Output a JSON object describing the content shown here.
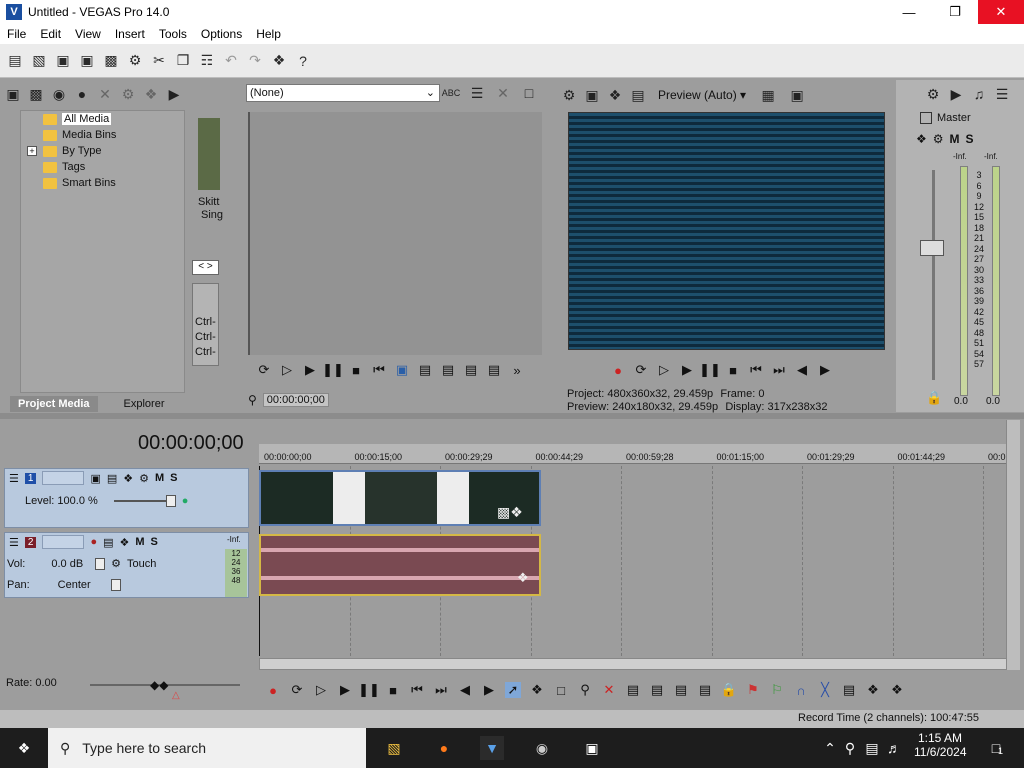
{
  "window": {
    "title": "Untitled - VEGAS Pro 14.0",
    "logo": "V"
  },
  "menu": [
    "File",
    "Edit",
    "View",
    "Insert",
    "Tools",
    "Options",
    "Help"
  ],
  "media_tree": {
    "items": [
      "All Media",
      "Media Bins",
      "By Type",
      "Tags",
      "Smart Bins"
    ],
    "expand_symbol": "+",
    "tabs": [
      "Project Media",
      "Explorer"
    ]
  },
  "thumbnails": {
    "caption1": "Skitt",
    "caption2": "Sing",
    "ctrl_lines": [
      "Ctrl-",
      "Ctrl-",
      "Ctrl-"
    ],
    "nav": "< >"
  },
  "trimmer": {
    "dropdown": "(None)",
    "timecode": "00:00:00;00"
  },
  "preview": {
    "mode": "Preview (Auto)",
    "project_label": "Project:",
    "project_value": "480x360x32, 29.459p",
    "frame_label": "Frame:",
    "frame_value": "0",
    "preview_label": "Preview:",
    "preview_value": "240x180x32, 29.459p",
    "display_label": "Display:",
    "display_value": "317x238x32"
  },
  "mixer": {
    "title": "Master",
    "inf_left": "-Inf.",
    "inf_right": "-Inf.",
    "scale": [
      "3",
      "6",
      "9",
      "12",
      "15",
      "18",
      "21",
      "24",
      "27",
      "30",
      "33",
      "36",
      "39",
      "42",
      "45",
      "48",
      "51",
      "54",
      "57"
    ],
    "bottom_left": "0.0",
    "bottom_right": "0.0"
  },
  "timeline": {
    "timecode": "00:00:00;00",
    "ruler": [
      "00:00:00;00",
      "00:00:15;00",
      "00:00:29;29",
      "00:00:44;29",
      "00:00:59;28",
      "00:01:15;00",
      "00:01:29;29",
      "00:01:44;29",
      "00:0"
    ],
    "video_track": {
      "number": "1",
      "level_label": "Level: 100.0 %"
    },
    "audio_track": {
      "number": "2",
      "vol_label": "Vol:",
      "vol_value": "0.0 dB",
      "pan_label": "Pan:",
      "pan_value": "Center",
      "automation": "Touch",
      "meter_top": "-Inf.",
      "meter_vals": [
        "12",
        "24",
        "36",
        "48"
      ]
    },
    "rate": "Rate: 0.00"
  },
  "status": {
    "record_time": "Record Time (2 channels): 100:47:55"
  },
  "taskbar": {
    "search_placeholder": "Type here to search",
    "time": "1:15 AM",
    "date": "11/6/2024",
    "notif_count": "1"
  },
  "colors": {
    "titlebar_close": "#e81123",
    "video_track": "#b8c9de",
    "audio_clip": "#7a4a52",
    "preview_stripe": "#1d4f6c"
  }
}
